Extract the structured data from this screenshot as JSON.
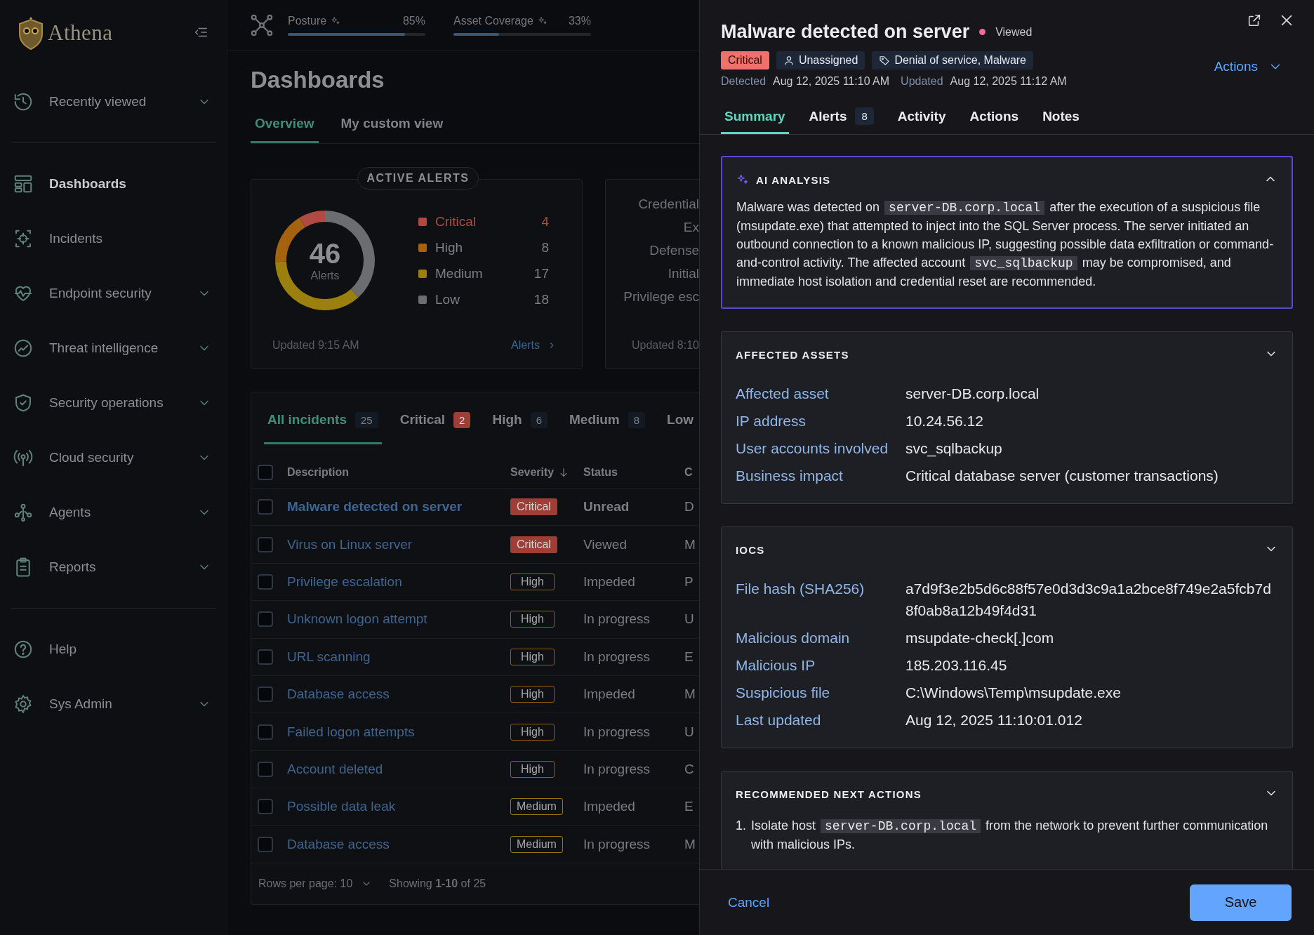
{
  "sidebar": {
    "logo_text": "Athena",
    "sections": [
      {
        "items": [
          {
            "label": "Recently viewed",
            "kind": "group",
            "selected": false
          }
        ]
      },
      {
        "items": [
          {
            "label": "Dashboards",
            "kind": "link",
            "selected": true
          },
          {
            "label": "Incidents",
            "kind": "link",
            "selected": false
          },
          {
            "label": "Endpoint security",
            "kind": "group",
            "selected": false
          },
          {
            "label": "Threat intelligence",
            "kind": "group",
            "selected": false
          },
          {
            "label": "Security operations",
            "kind": "group",
            "selected": false
          },
          {
            "label": "Cloud security",
            "kind": "group",
            "selected": false
          },
          {
            "label": "Agents",
            "kind": "group",
            "selected": false
          },
          {
            "label": "Reports",
            "kind": "group",
            "selected": false
          }
        ]
      },
      {
        "items": [
          {
            "label": "Help",
            "kind": "link",
            "selected": false
          },
          {
            "label": "Sys Admin",
            "kind": "group",
            "selected": false
          }
        ]
      }
    ]
  },
  "header": {
    "metrics": [
      {
        "label": "Posture",
        "value": "85%",
        "level": 0.85
      },
      {
        "label": "Asset Coverage",
        "value": "33%",
        "level": 0.33
      }
    ]
  },
  "page": {
    "title": "Dashboards",
    "tabs": [
      {
        "label": "Overview",
        "selected": true
      },
      {
        "label": "My custom view",
        "selected": false
      }
    ]
  },
  "active_alerts": {
    "title": "ACTIVE ALERTS",
    "total": "46",
    "total_label": "Alerts",
    "legend": [
      {
        "label": "Critical",
        "count": "4",
        "color": "#b04a42"
      },
      {
        "label": "High",
        "count": "8",
        "color": "#a5620f"
      },
      {
        "label": "Medium",
        "count": "17",
        "color": "#9c800f"
      },
      {
        "label": "Low",
        "count": "18",
        "color": "#6c6d70"
      }
    ],
    "updated": "Updated 9:15 AM",
    "link": "Alerts"
  },
  "second_card": {
    "labels": [
      "Credential",
      "Ex",
      "Defense",
      "Initial",
      "Privilege esc"
    ],
    "updated": "Updated 8:10"
  },
  "incidents": {
    "tabs": [
      {
        "label": "All incidents",
        "count": "25",
        "kind": "all",
        "selected": true
      },
      {
        "label": "Critical",
        "count": "2",
        "kind": "critical",
        "selected": false
      },
      {
        "label": "High",
        "count": "6",
        "kind": "high",
        "selected": false
      },
      {
        "label": "Medium",
        "count": "8",
        "kind": "medium",
        "selected": false
      },
      {
        "label": "Low",
        "kind": "low",
        "selected": false
      }
    ],
    "select_all": {
      "checked": false
    },
    "columns": [
      {
        "label": "Description",
        "sorted": false
      },
      {
        "label": "Severity",
        "sorted": true
      },
      {
        "label": "Status",
        "sorted": false
      },
      {
        "label": "C",
        "sorted": false
      }
    ],
    "rows": [
      {
        "description": "Malware detected on server",
        "severity": "Critical",
        "kind": "critical",
        "status": "Unread",
        "column_4": "D",
        "unread": true,
        "checked": false
      },
      {
        "description": "Virus on Linux server",
        "severity": "Critical",
        "kind": "critical",
        "status": "Viewed",
        "column_4": "M",
        "unread": false,
        "checked": false
      },
      {
        "description": "Privilege escalation",
        "severity": "High",
        "kind": "high",
        "status": "Impeded",
        "column_4": "P",
        "unread": false,
        "checked": false
      },
      {
        "description": "Unknown logon attempt",
        "severity": "High",
        "kind": "high",
        "status": "In progress",
        "column_4": "U",
        "unread": false,
        "checked": false
      },
      {
        "description": "URL scanning",
        "severity": "High",
        "kind": "high",
        "status": "In progress",
        "column_4": "E",
        "unread": false,
        "checked": false
      },
      {
        "description": "Database access",
        "severity": "High",
        "kind": "high",
        "status": "Impeded",
        "column_4": "M",
        "unread": false,
        "checked": false
      },
      {
        "description": "Failed logon attempts",
        "severity": "High",
        "kind": "high",
        "status": "In progress",
        "column_4": "U",
        "unread": false,
        "checked": false
      },
      {
        "description": "Account deleted",
        "severity": "High",
        "kind": "high",
        "status": "In progress",
        "column_4": "C",
        "unread": false,
        "checked": false
      },
      {
        "description": "Possible data leak",
        "severity": "Medium",
        "kind": "medium",
        "status": "Impeded",
        "column_4": "E",
        "unread": false,
        "checked": false
      },
      {
        "description": "Database access",
        "severity": "Medium",
        "kind": "medium",
        "status": "In progress",
        "column_4": "M",
        "unread": false,
        "checked": false
      }
    ],
    "rows_per_page": "Rows per page: 10",
    "showing": "Showing **1-10** of 25"
  },
  "incident_panel": {
    "title": "Malware detected on server",
    "status": "Viewed",
    "badges": [
      {
        "kind": "severity",
        "label": "Critical"
      },
      {
        "kind": "assignee",
        "label": "Unassigned"
      },
      {
        "kind": "tags",
        "label": "Denial of service, Malware"
      }
    ],
    "actions_label": "Actions",
    "meta": [
      {
        "label": "Detected",
        "value": "Aug 12, 2025 11:10 AM"
      },
      {
        "label": "Updated",
        "value": "Aug 12, 2025 11:12 AM"
      }
    ],
    "tabs": [
      {
        "label": "Summary",
        "selected": true
      },
      {
        "label": "Alerts",
        "count": "8",
        "selected": false
      },
      {
        "label": "Activity",
        "selected": false
      },
      {
        "label": "Actions",
        "selected": false
      },
      {
        "label": "Notes",
        "selected": false
      }
    ],
    "sections": [
      {
        "kind": "text",
        "title": "AI ANALYSIS",
        "expanded": true,
        "highlighted": true,
        "parts": [
          {
            "kind": "text",
            "text": "Malware was detected on "
          },
          {
            "kind": "code",
            "text": "server-DB.corp.local"
          },
          {
            "kind": "text",
            "text": " after the execution of a suspicious file (msupdate.exe) that attempted to inject into the SQL Server process. The server initiated an outbound connection to a known malicious IP, suggesting possible data exfiltration or command-and-control activity. The affected account "
          },
          {
            "kind": "code",
            "text": "svc_sqlbackup"
          },
          {
            "kind": "text",
            "text": " may be compromised, and immediate host isolation and credential reset are recommended."
          }
        ]
      },
      {
        "kind": "fields",
        "title": "AFFECTED ASSETS",
        "expanded": false,
        "highlighted": false,
        "fields": [
          {
            "label": "Affected asset",
            "value": "server-DB.corp.local"
          },
          {
            "label": "IP address",
            "value": "10.24.56.12"
          },
          {
            "label": "User accounts involved",
            "value": "svc_sqlbackup"
          },
          {
            "label": "Business impact",
            "value": "Critical database server (customer transactions)"
          }
        ]
      },
      {
        "kind": "fields",
        "title": "IOCS",
        "expanded": false,
        "highlighted": false,
        "fields": [
          {
            "label": "File hash (SHA256)",
            "value": "a7d9f3e2b5d6c88f57e0d3d3c9a1a2bce8f749e2a5fcb7d8f0ab8a12b49f4d31"
          },
          {
            "label": "Malicious domain",
            "value": "msupdate-check[.]com"
          },
          {
            "label": "Malicious IP",
            "value": "185.203.116.45"
          },
          {
            "label": "Suspicious file",
            "value": "C:\\Windows\\Temp\\msupdate.exe"
          },
          {
            "label": "Last updated",
            "value": "Aug 12, 2025 11:10:01.012"
          }
        ]
      },
      {
        "kind": "steps",
        "title": "RECOMMENDED NEXT ACTIONS",
        "expanded": false,
        "highlighted": false,
        "steps": [
          {
            "number": "1.",
            "parts": [
              {
                "kind": "text",
                "text": "Isolate host "
              },
              {
                "kind": "code",
                "text": "server-DB.corp.local"
              },
              {
                "kind": "text",
                "text": " from the network to prevent further communication with malicious IPs."
              }
            ]
          }
        ]
      }
    ],
    "cancel": "Cancel",
    "save": "Save"
  }
}
